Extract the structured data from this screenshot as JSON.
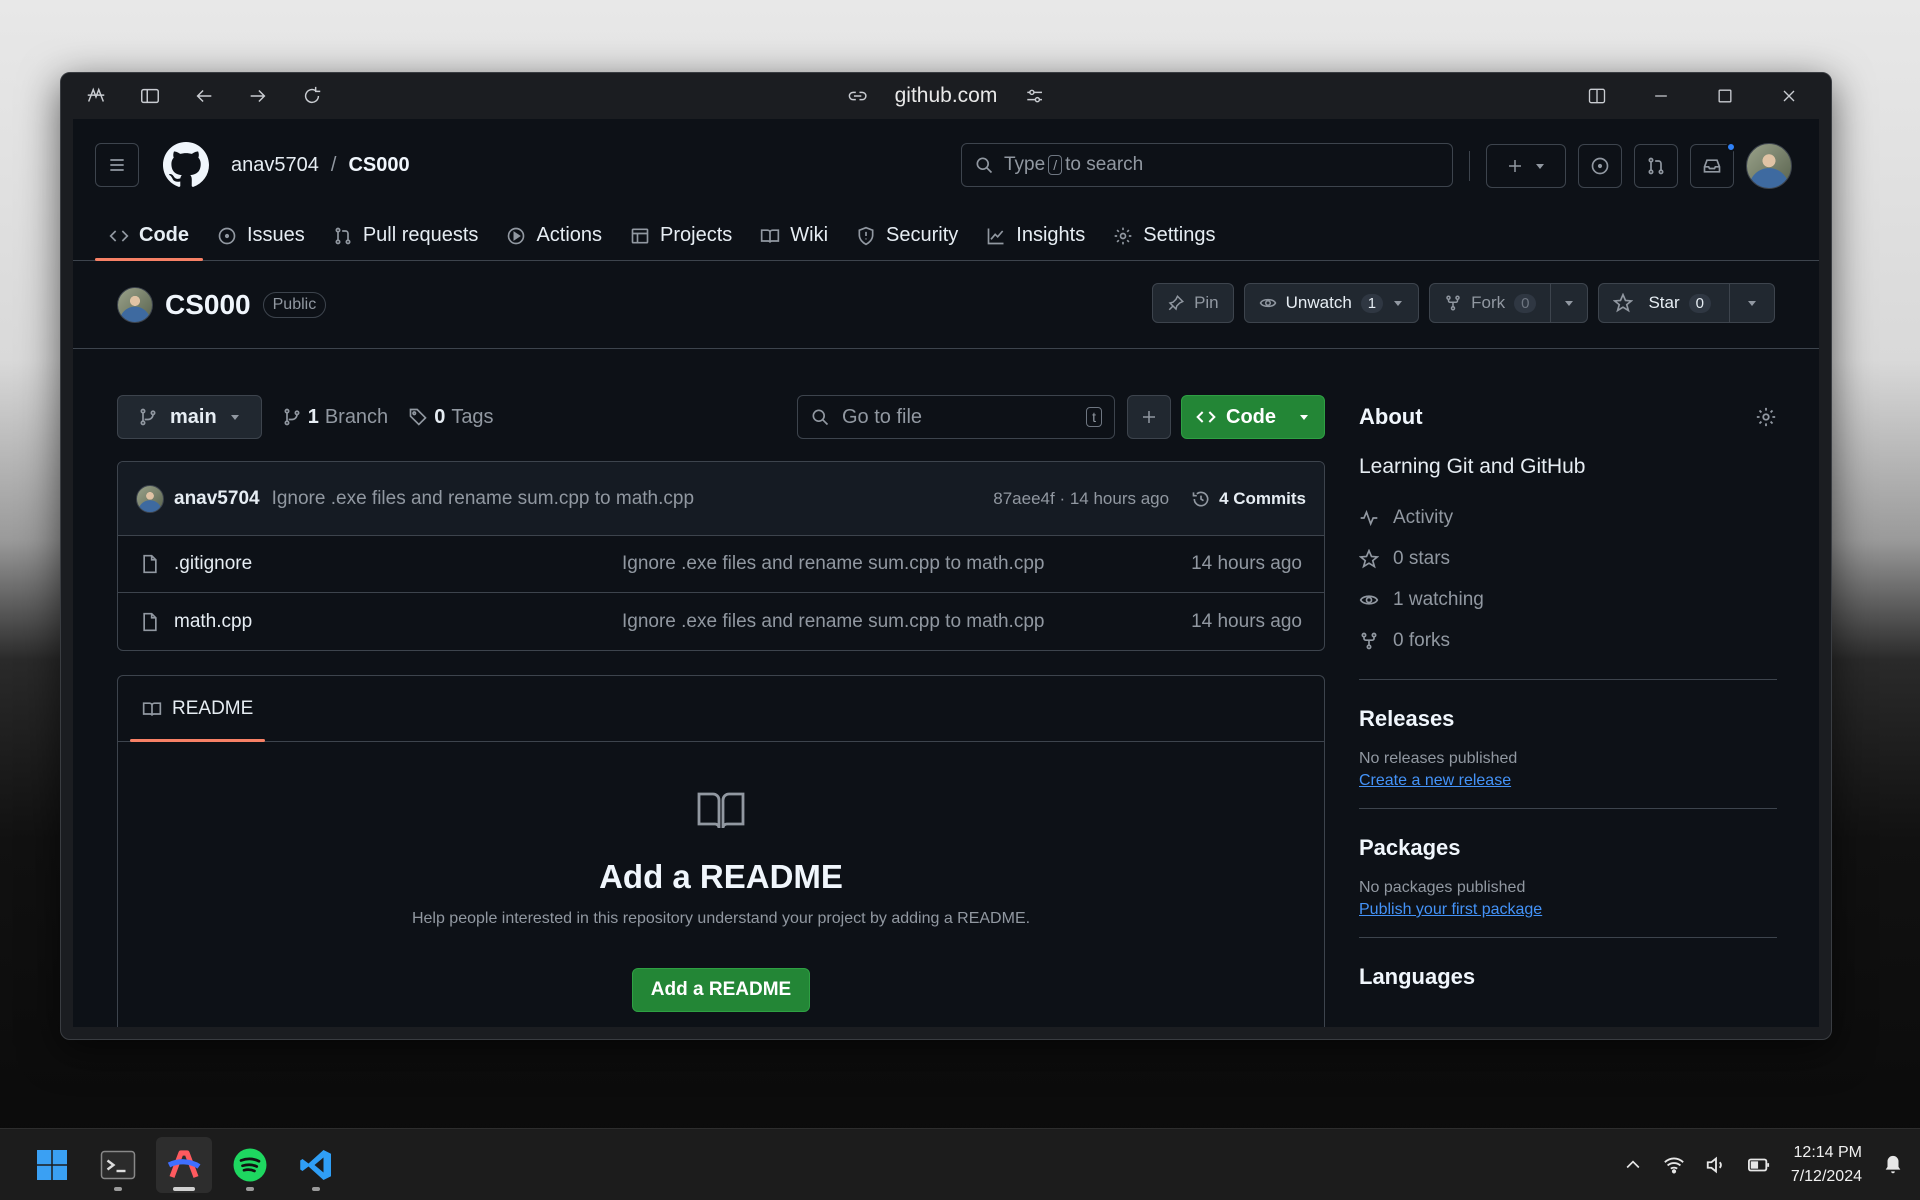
{
  "browser": {
    "url": "github.com"
  },
  "header": {
    "owner": "anav5704",
    "separator": "/",
    "repo": "CS000",
    "search_pre": "Type",
    "search_key": "/",
    "search_post": "to search"
  },
  "nav": {
    "tabs": [
      {
        "label": "Code",
        "icon": "code-icon",
        "active": true
      },
      {
        "label": "Issues",
        "icon": "issue-icon"
      },
      {
        "label": "Pull requests",
        "icon": "pull-request-icon"
      },
      {
        "label": "Actions",
        "icon": "play-icon"
      },
      {
        "label": "Projects",
        "icon": "table-icon"
      },
      {
        "label": "Wiki",
        "icon": "book-icon"
      },
      {
        "label": "Security",
        "icon": "shield-icon"
      },
      {
        "label": "Insights",
        "icon": "graph-icon"
      },
      {
        "label": "Settings",
        "icon": "gear-icon"
      }
    ]
  },
  "repo": {
    "name": "CS000",
    "visibility": "Public",
    "pin_label": "Pin",
    "unwatch_label": "Unwatch",
    "watch_count": "1",
    "fork_label": "Fork",
    "fork_count": "0",
    "star_label": "Star",
    "star_count": "0"
  },
  "toolbar": {
    "branch": "main",
    "branch_count": "1",
    "branch_label": "Branch",
    "tag_count": "0",
    "tag_label": "Tags",
    "goto_placeholder": "Go to file",
    "goto_key": "t",
    "code_label": "Code"
  },
  "commit": {
    "author": "anav5704",
    "message": "Ignore .exe files and rename sum.cpp to math.cpp",
    "meta": "87aee4f · 14 hours ago",
    "commits_label": "4 Commits"
  },
  "files": [
    {
      "name": ".gitignore",
      "message": "Ignore .exe files and rename sum.cpp to math.cpp",
      "time": "14 hours ago"
    },
    {
      "name": "math.cpp",
      "message": "Ignore .exe files and rename sum.cpp to math.cpp",
      "time": "14 hours ago"
    }
  ],
  "readme": {
    "tab": "README",
    "heading": "Add a README",
    "text": "Help people interested in this repository understand your project by adding a README.",
    "button": "Add a README"
  },
  "about": {
    "title": "About",
    "description": "Learning Git and GitHub",
    "activity": "Activity",
    "stars": "0 stars",
    "watching": "1 watching",
    "forks": "0 forks"
  },
  "releases": {
    "title": "Releases",
    "text": "No releases published",
    "link": "Create a new release"
  },
  "packages": {
    "title": "Packages",
    "text": "No packages published",
    "link": "Publish your first package"
  },
  "languages": {
    "title": "Languages"
  },
  "taskbar": {
    "time": "12:14 PM",
    "date": "7/12/2024"
  },
  "colors": {
    "accent_green": "#238636",
    "tab_underline": "#f78166",
    "link_blue": "#4493f8",
    "bg": "#0d1117"
  }
}
